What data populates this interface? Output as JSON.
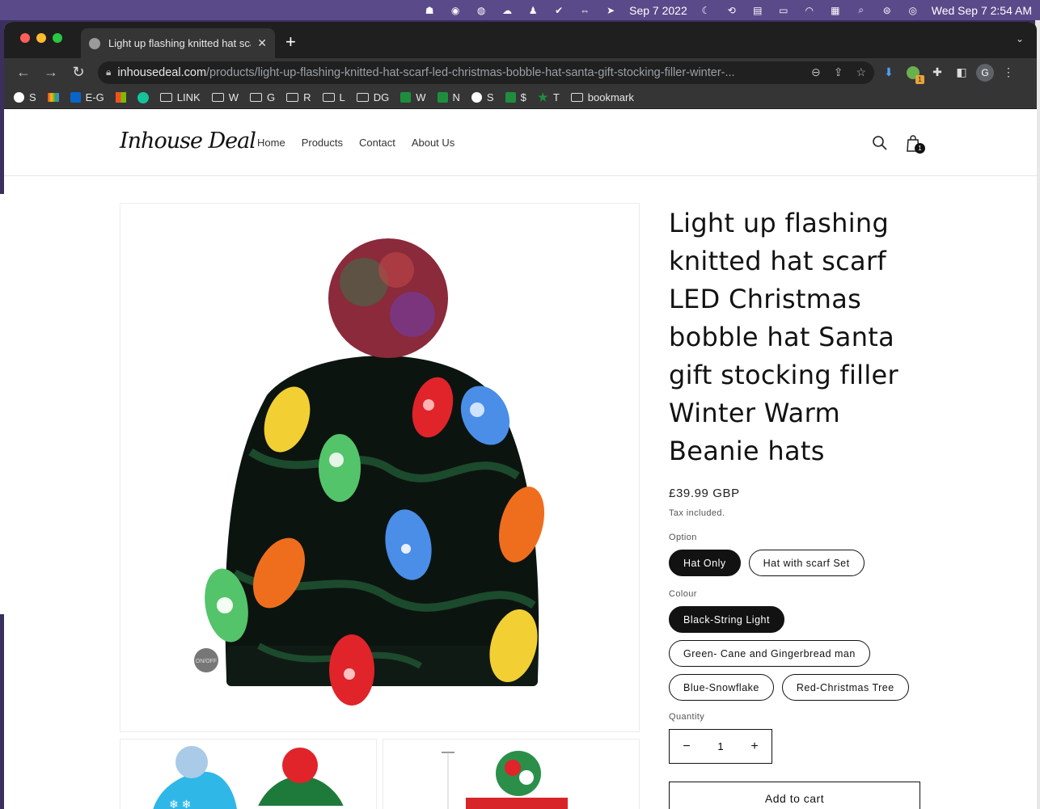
{
  "menubar": {
    "date": "Sep 7 2022",
    "clock": "Wed Sep 7  2:54 AM"
  },
  "browser": {
    "tab_title": "Light up flashing knitted hat scarf LED Christmas bobble hat Santa gift stocking filler Winter Warm Beanie hats",
    "url_domain": "inhousedeal.com",
    "url_path": "/products/light-up-flashing-knitted-hat-scarf-led-christmas-bobble-hat-santa-gift-stocking-filler-winter-...",
    "profile_initial": "G",
    "extension_badge": "1",
    "bookmarks": [
      {
        "label": "S",
        "icon": "globe-icon"
      },
      {
        "label": "",
        "icon": "gmail-icon"
      },
      {
        "label": "E-G",
        "icon": "outlook-icon"
      },
      {
        "label": "",
        "icon": "microsoft-icon"
      },
      {
        "label": "",
        "icon": "grammarly-icon"
      },
      {
        "label": "LINK",
        "icon": "folder-icon"
      },
      {
        "label": "W",
        "icon": "folder-icon"
      },
      {
        "label": "G",
        "icon": "folder-icon"
      },
      {
        "label": "R",
        "icon": "folder-icon"
      },
      {
        "label": "L",
        "icon": "folder-icon"
      },
      {
        "label": "DG",
        "icon": "folder-icon"
      },
      {
        "label": "W",
        "icon": "green-t-icon"
      },
      {
        "label": "N",
        "icon": "green-t-icon"
      },
      {
        "label": "S",
        "icon": "globe-icon"
      },
      {
        "label": "$",
        "icon": "green-t-icon"
      },
      {
        "label": "T",
        "icon": "star-icon"
      },
      {
        "label": "bookmark",
        "icon": "folder-icon"
      }
    ]
  },
  "site": {
    "logo": "Inhouse Deal",
    "nav": [
      "Home",
      "Products",
      "Contact",
      "About Us"
    ],
    "cart_count": "1"
  },
  "product": {
    "title": "Light up flashing knitted hat scarf LED Christmas bobble hat Santa gift stocking filler Winter Warm Beanie hats",
    "price": "£39.99 GBP",
    "tax_note": "Tax included.",
    "option_label": "Option",
    "options": [
      {
        "label": "Hat Only",
        "selected": true
      },
      {
        "label": "Hat with scarf Set",
        "selected": false
      }
    ],
    "colour_label": "Colour",
    "colours": [
      {
        "label": "Black-String Light",
        "selected": true
      },
      {
        "label": "Green- Cane and Gingerbread man",
        "selected": false
      },
      {
        "label": "Blue-Snowflake",
        "selected": false
      },
      {
        "label": "Red-Christmas Tree",
        "selected": false
      }
    ],
    "quantity_label": "Quantity",
    "quantity": "1",
    "add_to_cart": "Add to cart",
    "hat_badge": "ON/OFF"
  }
}
